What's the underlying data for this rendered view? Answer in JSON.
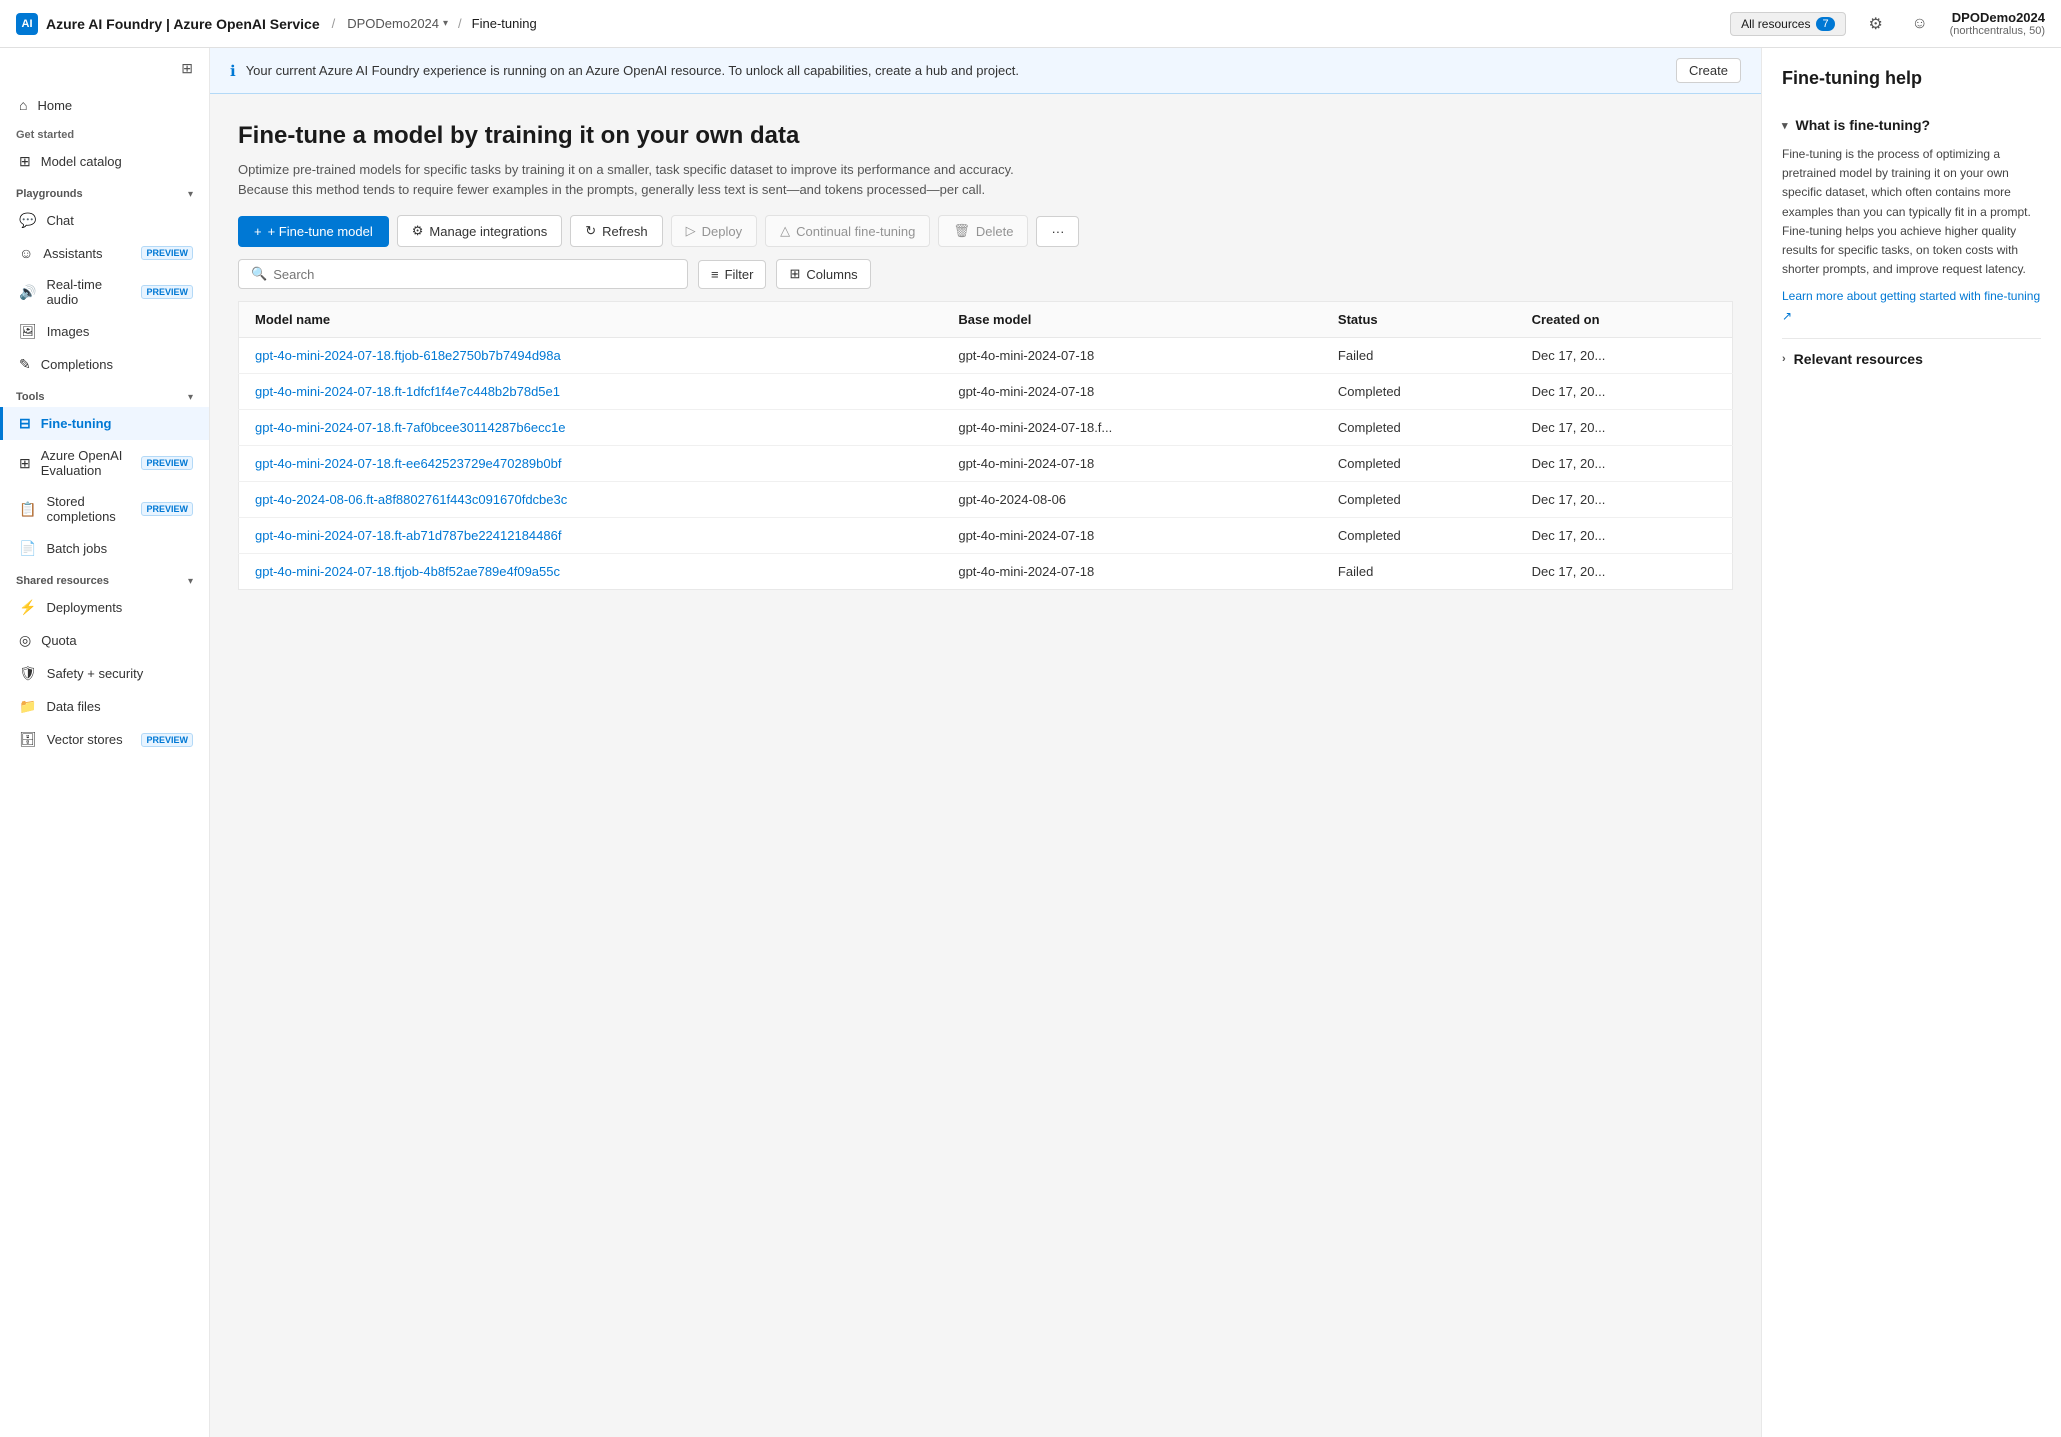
{
  "topbar": {
    "logo_label": "AI",
    "brand": "Azure AI Foundry | Azure OpenAI Service",
    "workspace": "DPODemo2024",
    "page": "Fine-tuning",
    "all_resources_label": "All resources",
    "resource_count": "7",
    "user_name": "DPODemo2024",
    "user_region": "(northcentralus, 50)"
  },
  "info_banner": {
    "text": "Your current Azure AI Foundry experience is running on an Azure OpenAI resource. To unlock all capabilities, create a hub and project.",
    "create_label": "Create"
  },
  "sidebar": {
    "toggle_icon": "⊞",
    "home_label": "Home",
    "get_started_label": "Get started",
    "model_catalog_label": "Model catalog",
    "playgrounds_label": "Playgrounds",
    "playgrounds_open": true,
    "chat_label": "Chat",
    "assistants_label": "Assistants",
    "assistants_preview": "PREVIEW",
    "realtime_audio_label": "Real-time audio",
    "realtime_audio_preview": "PREVIEW",
    "images_label": "Images",
    "completions_label": "Completions",
    "tools_label": "Tools",
    "tools_open": true,
    "fine_tuning_label": "Fine-tuning",
    "azure_openai_eval_label": "Azure OpenAI Evaluation",
    "azure_openai_eval_preview": "PREVIEW",
    "stored_completions_label": "Stored completions",
    "stored_completions_preview": "PREVIEW",
    "batch_jobs_label": "Batch jobs",
    "shared_resources_label": "Shared resources",
    "shared_resources_open": true,
    "deployments_label": "Deployments",
    "quota_label": "Quota",
    "safety_security_label": "Safety + security",
    "data_files_label": "Data files",
    "vector_stores_label": "Vector stores",
    "vector_stores_preview": "PREVIEW"
  },
  "page": {
    "title": "Fine-tune a model by training it on your own data",
    "description": "Optimize pre-trained models for specific tasks by training it on a smaller, task specific dataset to improve its performance and accuracy. Because this method tends to require fewer examples in the prompts, generally less text is sent—and tokens processed—per call.",
    "fine_tune_btn": "+ Fine-tune model",
    "manage_integrations_btn": "Manage integrations",
    "refresh_btn": "Refresh",
    "deploy_btn": "Deploy",
    "continual_fine_tuning_btn": "Continual fine-tuning",
    "delete_btn": "Delete",
    "more_btn": "···"
  },
  "table": {
    "search_placeholder": "Search",
    "filter_btn": "Filter",
    "columns_btn": "Columns",
    "headers": [
      "Model name",
      "Base model",
      "Status",
      "Created on"
    ],
    "rows": [
      {
        "model_name": "gpt-4o-mini-2024-07-18.ftjob-618e2750b7b7494d98a",
        "base_model": "gpt-4o-mini-2024-07-18",
        "status": "Failed",
        "status_type": "failed",
        "created_on": "Dec 17, 20..."
      },
      {
        "model_name": "gpt-4o-mini-2024-07-18.ft-1dfcf1f4e7c448b2b78d5e1",
        "base_model": "gpt-4o-mini-2024-07-18",
        "status": "Completed",
        "status_type": "completed",
        "created_on": "Dec 17, 20..."
      },
      {
        "model_name": "gpt-4o-mini-2024-07-18.ft-7af0bcee30114287b6ecc1e",
        "base_model": "gpt-4o-mini-2024-07-18.f...",
        "status": "Completed",
        "status_type": "completed",
        "created_on": "Dec 17, 20..."
      },
      {
        "model_name": "gpt-4o-mini-2024-07-18.ft-ee642523729e470289b0bf",
        "base_model": "gpt-4o-mini-2024-07-18",
        "status": "Completed",
        "status_type": "completed",
        "created_on": "Dec 17, 20..."
      },
      {
        "model_name": "gpt-4o-2024-08-06.ft-a8f8802761f443c091670fdcbe3c",
        "base_model": "gpt-4o-2024-08-06",
        "status": "Completed",
        "status_type": "completed",
        "created_on": "Dec 17, 20..."
      },
      {
        "model_name": "gpt-4o-mini-2024-07-18.ft-ab71d787be22412184486f",
        "base_model": "gpt-4o-mini-2024-07-18",
        "status": "Completed",
        "status_type": "completed",
        "created_on": "Dec 17, 20..."
      },
      {
        "model_name": "gpt-4o-mini-2024-07-18.ftjob-4b8f52ae789e4f09a55c",
        "base_model": "gpt-4o-mini-2024-07-18",
        "status": "Failed",
        "status_type": "failed",
        "created_on": "Dec 17, 20..."
      }
    ]
  },
  "help_panel": {
    "title": "Fine-tuning help",
    "what_is_label": "What is fine-tuning?",
    "what_is_body": "Fine-tuning is the process of optimizing a pretrained model by training it on your own specific dataset, which often contains more examples than you can typically fit in a prompt. Fine-tuning helps you achieve higher quality results for specific tasks, on token costs with shorter prompts, and improve request latency.",
    "learn_more_link": "Learn more about getting started with fine-tuning ↗",
    "relevant_resources_label": "Relevant resources"
  }
}
